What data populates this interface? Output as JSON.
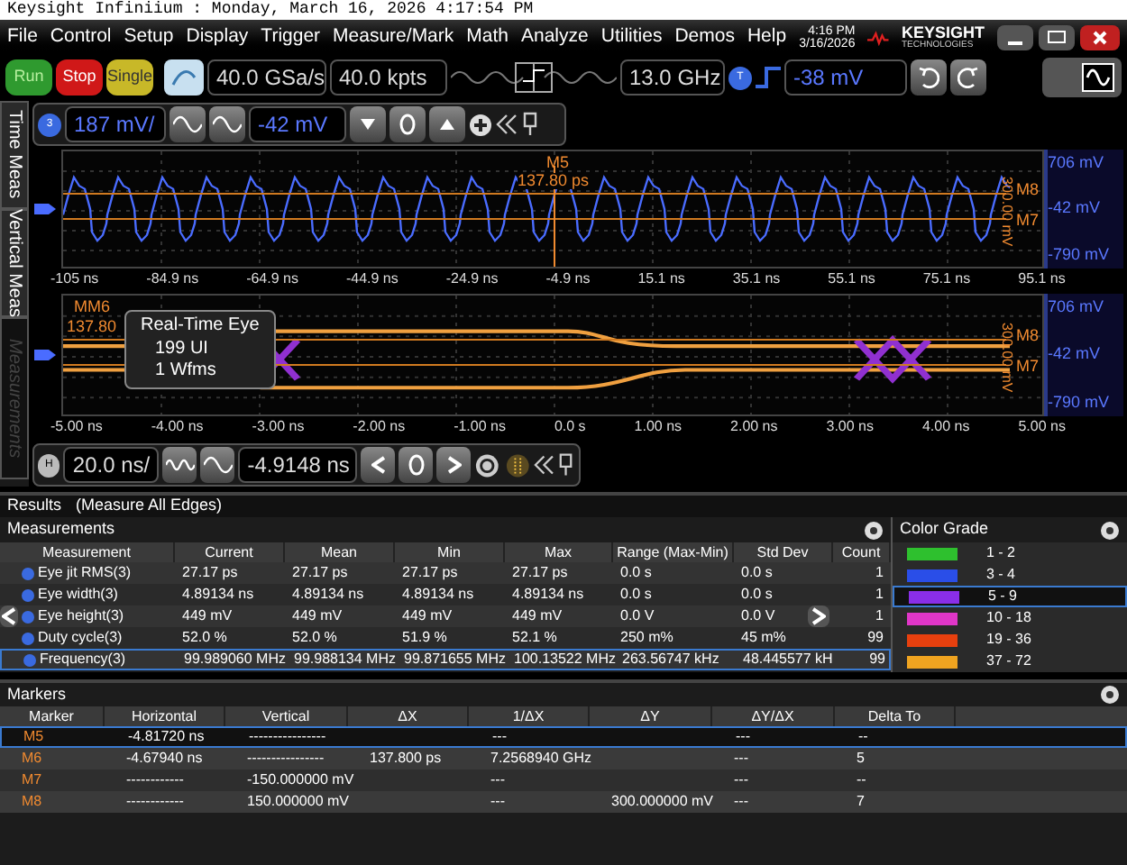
{
  "title_bar": "Keysight Infiniium : Monday, March 16, 2026 4:17:54 PM",
  "menu": [
    "File",
    "Control",
    "Setup",
    "Display",
    "Trigger",
    "Measure/Mark",
    "Math",
    "Analyze",
    "Utilities",
    "Demos",
    "Help"
  ],
  "clock": {
    "time": "4:16 PM",
    "date": "3/16/2026"
  },
  "brand": {
    "name": "KEYSIGHT",
    "sub": "TECHNOLOGIES"
  },
  "run_buttons": [
    {
      "label": "Run",
      "kind": "run"
    },
    {
      "label": "Stop",
      "kind": "stop"
    },
    {
      "label": "Single",
      "kind": "single"
    }
  ],
  "acquisition": {
    "sample_rate": "40.0 GSa/s",
    "memory": "40.0 kpts",
    "bandwidth": "13.0 GHz"
  },
  "trigger": {
    "channel": "T",
    "level": "-38 mV"
  },
  "side_tabs": [
    {
      "label": "Time Meas",
      "disabled": false
    },
    {
      "label": "Vertical Meas",
      "disabled": false
    },
    {
      "label": "Measurements",
      "disabled": true
    }
  ],
  "channel": {
    "number": "3",
    "scale": "187 mV/",
    "offset": "-42 mV"
  },
  "waveform": {
    "marker_top": "M5",
    "delta": "137.80 ps",
    "marker_high": "M8",
    "marker_low": "M7",
    "delta_v": "300.00 mV",
    "y_labels": [
      "706 mV",
      "-42 mV",
      "-790 mV"
    ],
    "x_labels": [
      "-105 ns",
      "-84.9 ns",
      "-64.9 ns",
      "-44.9 ns",
      "-24.9 ns",
      "-4.9 ns",
      "15.1 ns",
      "35.1 ns",
      "55.1 ns",
      "75.1 ns",
      "95.1 ns"
    ]
  },
  "eye": {
    "marker_top": "MM6",
    "delta": "137.80",
    "marker_high": "M8",
    "marker_low": "M7",
    "delta_v": "300.00 mV",
    "y_labels": [
      "706 mV",
      "-42 mV",
      "-790 mV"
    ],
    "x_labels": [
      "-5.00 ns",
      "-4.00 ns",
      "-3.00 ns",
      "-2.00 ns",
      "-1.00 ns",
      "0.0 s",
      "1.00 ns",
      "2.00 ns",
      "3.00 ns",
      "4.00 ns",
      "5.00 ns"
    ],
    "overlay": [
      "Real-Time Eye",
      "199 UI",
      "1 Wfms"
    ]
  },
  "horizontal": {
    "channel": "H",
    "scale": "20.0 ns/",
    "position": "-4.9148 ns"
  },
  "results": {
    "title": "Results",
    "subtitle": "(Measure All Edges)"
  },
  "measurements": {
    "title": "Measurements",
    "columns": [
      "Measurement",
      "Current",
      "Mean",
      "Min",
      "Max",
      "Range (Max-Min)",
      "Std Dev",
      "Count"
    ],
    "rows": [
      {
        "cells": [
          "Eye jit RMS(3)",
          "27.17 ps",
          "27.17 ps",
          "27.17 ps",
          "27.17 ps",
          "0.0 s",
          "0.0 s",
          "1"
        ],
        "selected": false
      },
      {
        "cells": [
          "Eye width(3)",
          "4.89134 ns",
          "4.89134 ns",
          "4.89134 ns",
          "4.89134 ns",
          "0.0 s",
          "0.0 s",
          "1"
        ],
        "selected": false
      },
      {
        "cells": [
          "Eye height(3)",
          "449 mV",
          "449 mV",
          "449 mV",
          "449 mV",
          "0.0 V",
          "0.0 V",
          "1"
        ],
        "selected": false
      },
      {
        "cells": [
          "Duty cycle(3)",
          "52.0 %",
          "52.0 %",
          "51.9 %",
          "52.1 %",
          "250 m%",
          "45 m%",
          "99"
        ],
        "selected": false
      },
      {
        "cells": [
          "Frequency(3)",
          "99.989060 MHz",
          "99.988134 MHz",
          "99.871655 MHz",
          "100.13522 MHz",
          "263.56747 kHz",
          "48.445577 kH",
          "99"
        ],
        "selected": true
      }
    ]
  },
  "color_grade": {
    "title": "Color Grade",
    "items": [
      {
        "label": "1 - 2",
        "color": "#2ec02e",
        "selected": false
      },
      {
        "label": "3 - 4",
        "color": "#2a4ee8",
        "selected": false
      },
      {
        "label": "5 - 9",
        "color": "#8a2ee8",
        "selected": true
      },
      {
        "label": "10 - 18",
        "color": "#e036c8",
        "selected": false
      },
      {
        "label": "19 - 36",
        "color": "#e8400e",
        "selected": false
      },
      {
        "label": "37 - 72",
        "color": "#f0a420",
        "selected": false
      }
    ]
  },
  "markers": {
    "title": "Markers",
    "columns": [
      "Marker",
      "Horizontal",
      "Vertical",
      "ΔX",
      "1/ΔX",
      "ΔY",
      "ΔY/ΔX",
      "Delta To"
    ],
    "rows": [
      {
        "cells": [
          "M5",
          "-4.81720 ns",
          "----------------",
          "",
          "---",
          "",
          "---",
          "--"
        ],
        "selected": true
      },
      {
        "cells": [
          "M6",
          "-4.67940 ns",
          "----------------",
          "137.800 ps",
          "7.2568940 GHz",
          "",
          "---",
          "5"
        ],
        "selected": false
      },
      {
        "cells": [
          "M7",
          "------------",
          "-150.000000 mV",
          "",
          "---",
          "",
          "---",
          "--"
        ],
        "selected": false
      },
      {
        "cells": [
          "M8",
          "------------",
          "150.000000 mV",
          "",
          "---",
          "300.000000 mV",
          "---",
          "7"
        ],
        "selected": false
      }
    ]
  }
}
